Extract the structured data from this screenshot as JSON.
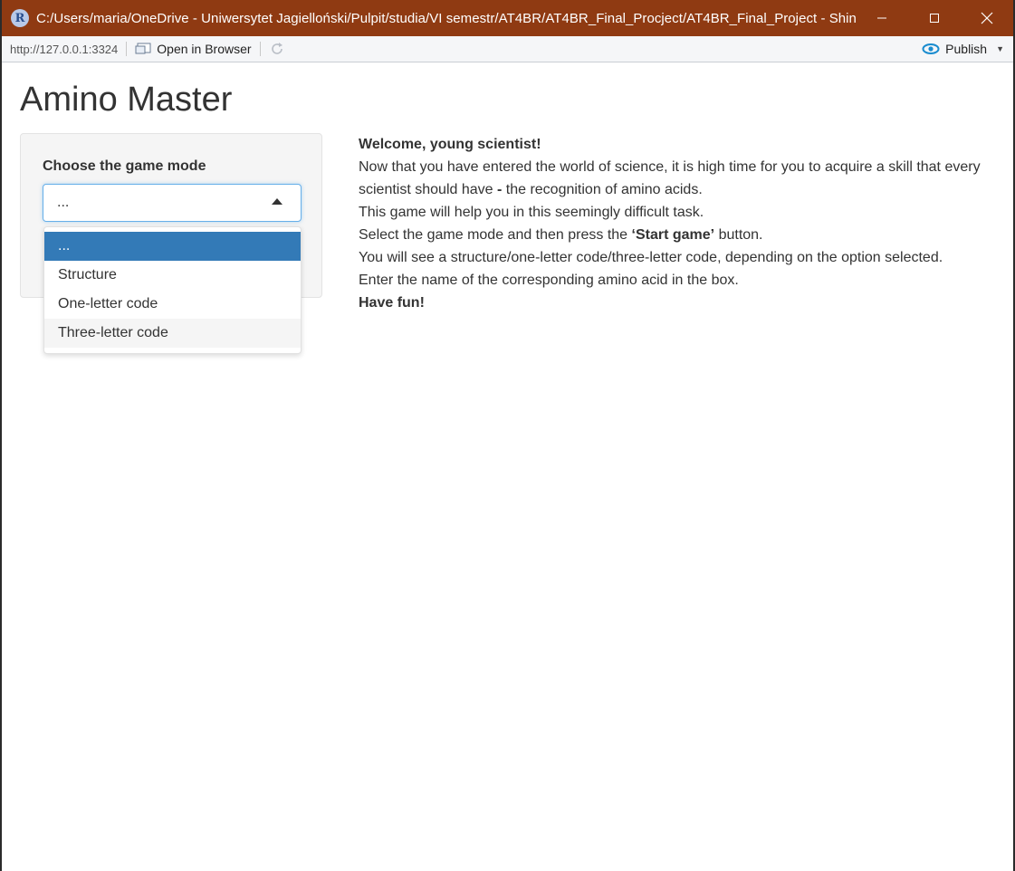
{
  "window": {
    "title": "C:/Users/maria/OneDrive - Uniwersytet Jagielloński/Pulpit/studia/VI semestr/AT4BR/AT4BR_Final_Procject/AT4BR_Final_Project - Shiny",
    "app_icon": "R",
    "colors": {
      "titlebar": "#8f3a12"
    }
  },
  "toolbar": {
    "url": "http://127.0.0.1:3324",
    "open_in_browser": "Open in Browser",
    "publish": "Publish"
  },
  "app": {
    "title": "Amino Master",
    "sidebar": {
      "mode_label": "Choose the game mode",
      "select_value": "...",
      "options": [
        "...",
        "Structure",
        "One-letter code",
        "Three-letter code"
      ],
      "selected_index": 0,
      "hover_index": 3
    },
    "intro": {
      "greeting": "Welcome, young scientist!",
      "line1": "Now that you have entered the world of science, it is high time for you to acquire a skill that every scientist should have ",
      "line1_dash": "-",
      "line1_end": " the recognition of amino acids.",
      "line2": "This game will help you in this seemingly difficult task.",
      "line3_start": "Select the game mode and then press the ",
      "line3_bold": "‘Start game’",
      "line3_end": " button.",
      "line4": "You will see a structure/one-letter code/three-letter code, depending on the option selected.",
      "line5": "Enter the name of the corresponding amino acid in the box.",
      "closing": "Have fun!"
    },
    "colors": {
      "accent": "#337ab7",
      "focus_border": "#66afe9"
    }
  }
}
